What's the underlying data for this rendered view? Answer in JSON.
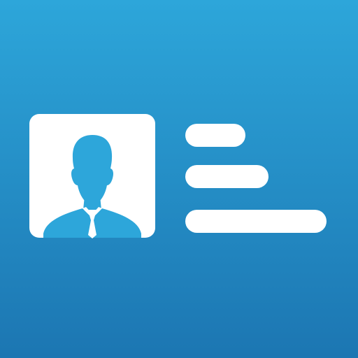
{
  "icon": {
    "name": "contact-card-icon",
    "colors": {
      "background_top": "#2DA6DA",
      "background_bottom": "#1C76B2",
      "foreground": "#FFFFFF"
    }
  }
}
